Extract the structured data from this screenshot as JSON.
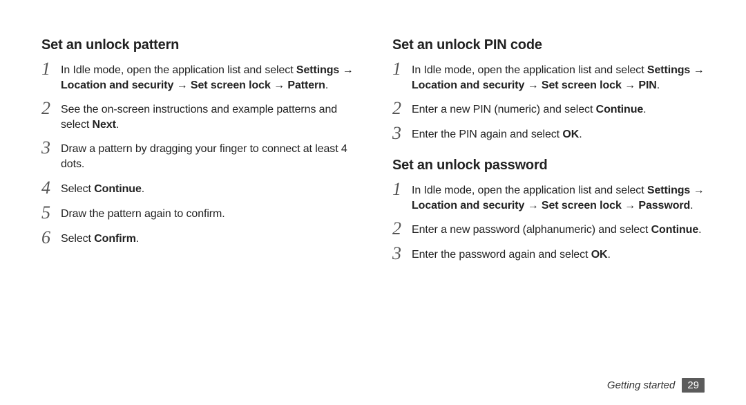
{
  "footer": {
    "section": "Getting started",
    "page": "29"
  },
  "left": {
    "heading": "Set an unlock pattern",
    "steps": [
      {
        "n": "1",
        "html": "In Idle mode, open the application list and select <b>Settings</b> → <b>Location and security</b> → <b>Set screen lock</b> → <b>Pattern</b>."
      },
      {
        "n": "2",
        "html": "See the on-screen instructions and example patterns and select <b>Next</b>."
      },
      {
        "n": "3",
        "html": "Draw a pattern by dragging your finger to connect at least 4 dots."
      },
      {
        "n": "4",
        "html": "Select <b>Continue</b>."
      },
      {
        "n": "5",
        "html": "Draw the pattern again to confirm."
      },
      {
        "n": "6",
        "html": "Select <b>Confirm</b>."
      }
    ]
  },
  "right": [
    {
      "heading": "Set an unlock PIN code",
      "steps": [
        {
          "n": "1",
          "html": "In Idle mode, open the application list and select <b>Settings</b> → <b>Location and security</b> → <b>Set screen lock</b> → <b>PIN</b>."
        },
        {
          "n": "2",
          "html": "Enter a new PIN (numeric) and select <b>Continue</b>."
        },
        {
          "n": "3",
          "html": "Enter the PIN again and select <b>OK</b>."
        }
      ]
    },
    {
      "heading": "Set an unlock password",
      "steps": [
        {
          "n": "1",
          "html": "In Idle mode, open the application list and select <b>Settings</b> → <b>Location and security</b> → <b>Set screen lock</b> → <b>Password</b>."
        },
        {
          "n": "2",
          "html": "Enter a new password (alphanumeric) and select <b>Continue</b>."
        },
        {
          "n": "3",
          "html": "Enter the password again and select <b>OK</b>."
        }
      ]
    }
  ]
}
